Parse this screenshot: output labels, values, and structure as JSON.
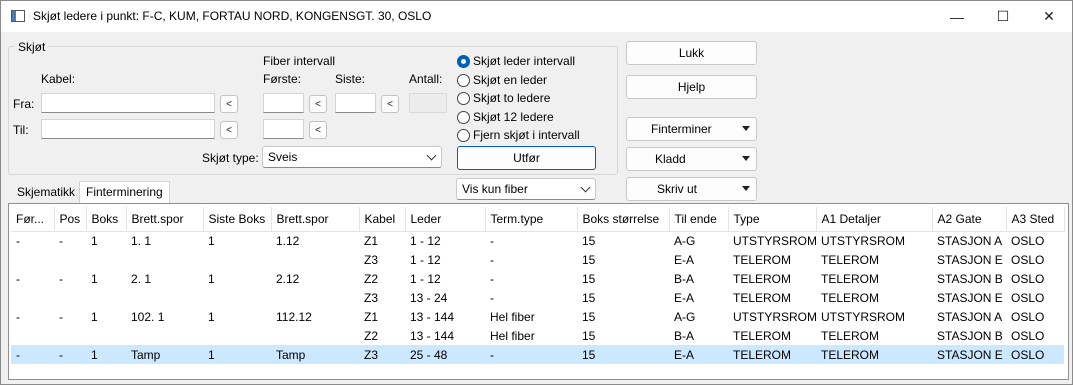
{
  "window": {
    "title": "Skjøt ledere i punkt: F-C, KUM, FORTAU NORD, KONGENSGT. 30, OSLO",
    "controls": {
      "minimize": "—",
      "maximize": "☐",
      "close": "✕"
    }
  },
  "group": {
    "title": "Skjøt",
    "kabel_label": "Kabel:",
    "fra_label": "Fra:",
    "til_label": "Til:",
    "fra_value": "",
    "til_value": "",
    "fiber_interval_label": "Fiber intervall",
    "forste_label": "Første:",
    "siste_label": "Siste:",
    "antall_label": "Antall:",
    "forste_fra_value": "",
    "forste_til_value": "",
    "siste_value": "",
    "antall_value": "",
    "pick_symbol": "<",
    "skjot_type_label": "Skjøt type:",
    "skjot_type_value": "Sveis"
  },
  "radios": [
    {
      "label": "Skjøt leder intervall",
      "checked": true
    },
    {
      "label": "Skjøt en leder",
      "checked": false
    },
    {
      "label": "Skjøt to ledere",
      "checked": false
    },
    {
      "label": "Skjøt 12 ledere",
      "checked": false
    },
    {
      "label": "Fjern skjøt i intervall",
      "checked": false
    }
  ],
  "buttons": {
    "utfor": "Utfør",
    "lukk": "Lukk",
    "hjelp": "Hjelp",
    "finterminer": "Finterminer",
    "kladd": "Kladd",
    "skriv_ut": "Skriv ut"
  },
  "filter": {
    "value": "Vis kun fiber"
  },
  "tabs": [
    {
      "label": "Skjematikk",
      "active": false
    },
    {
      "label": "Finterminering",
      "active": true
    }
  ],
  "table": {
    "columns": [
      "Før...",
      "Pos",
      "Boks",
      "Brett.spor",
      "Siste Boks",
      "Brett.spor",
      "Kabel",
      "Leder",
      "Term.type",
      "Boks størrelse",
      "Til ende",
      "Type",
      "A1 Detaljer",
      "A2 Gate",
      "A3 Sted"
    ],
    "rows": [
      [
        "-",
        "-",
        "1",
        "1. 1",
        "1",
        "1.12",
        "Z1",
        "1 - 12",
        "-",
        "15",
        "A-G",
        "UTSTYRSROM",
        "UTSTYRSROM",
        "STASJON A",
        "OSLO"
      ],
      [
        "",
        "",
        "",
        "",
        "",
        "",
        "Z3",
        "1 - 12",
        "-",
        "15",
        "E-A",
        "TELEROM",
        "TELEROM",
        "STASJON E",
        "OSLO"
      ],
      [
        "-",
        "-",
        "1",
        "2. 1",
        "1",
        "2.12",
        "Z2",
        "1 - 12",
        "-",
        "15",
        "B-A",
        "TELEROM",
        "TELEROM",
        "STASJON B",
        "OSLO"
      ],
      [
        "",
        "",
        "",
        "",
        "",
        "",
        "Z3",
        "13 - 24",
        "-",
        "15",
        "E-A",
        "TELEROM",
        "TELEROM",
        "STASJON E",
        "OSLO"
      ],
      [
        "-",
        "-",
        "1",
        "102. 1",
        "1",
        "112.12",
        "Z1",
        "13 - 144",
        "Hel fiber",
        "15",
        "A-G",
        "UTSTYRSROM",
        "UTSTYRSROM",
        "STASJON A",
        "OSLO"
      ],
      [
        "",
        "",
        "",
        "",
        "",
        "",
        "Z2",
        "13 - 144",
        "Hel fiber",
        "15",
        "B-A",
        "TELEROM",
        "TELEROM",
        "STASJON B",
        "OSLO"
      ],
      [
        "-",
        "-",
        "1",
        "Tamp",
        "1",
        "Tamp",
        "Z3",
        "25 - 48",
        "-",
        "15",
        "E-A",
        "TELEROM",
        "TELEROM",
        "STASJON E",
        "OSLO"
      ]
    ],
    "selected_row": 6
  }
}
